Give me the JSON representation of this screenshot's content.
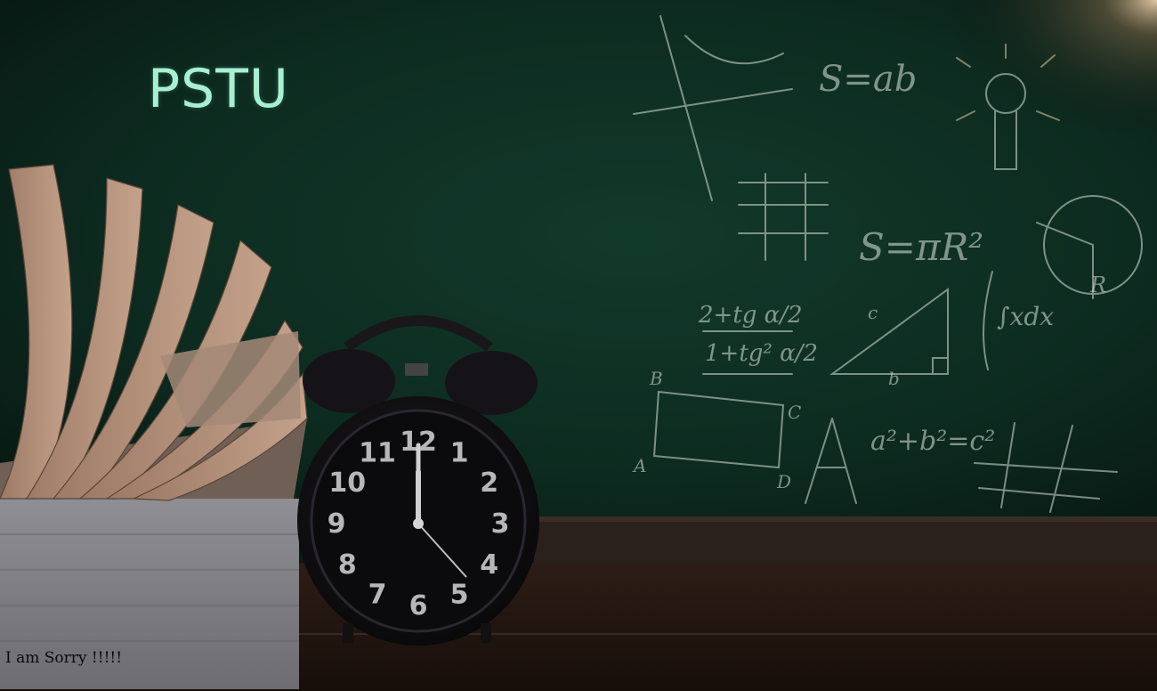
{
  "scene": {
    "title": "PSTU",
    "caption": "I am Sorry !!!!!",
    "colors": {
      "chalkboard": "#0f3326",
      "chalkboard_dark": "#07160f",
      "chalk": "#c7d3c8",
      "title": "#a8f0d2",
      "desk": "#2a1a14",
      "clock_body": "#121014",
      "book_pages": "#b08d76"
    }
  },
  "chalkboard": {
    "formulas": [
      "S=ab",
      "S=πR²",
      "2+tg α/2",
      "1+tg² α/2",
      "∫xdx",
      "a²+b²=c²"
    ],
    "labels": [
      "R",
      "B",
      "C",
      "A",
      "D",
      "c",
      "b"
    ]
  },
  "clock": {
    "numbers": [
      "12",
      "1",
      "2",
      "3",
      "4",
      "5",
      "6",
      "7",
      "8",
      "9",
      "10",
      "11"
    ],
    "time": {
      "hour": 12,
      "minute": 0,
      "second": 23
    }
  }
}
